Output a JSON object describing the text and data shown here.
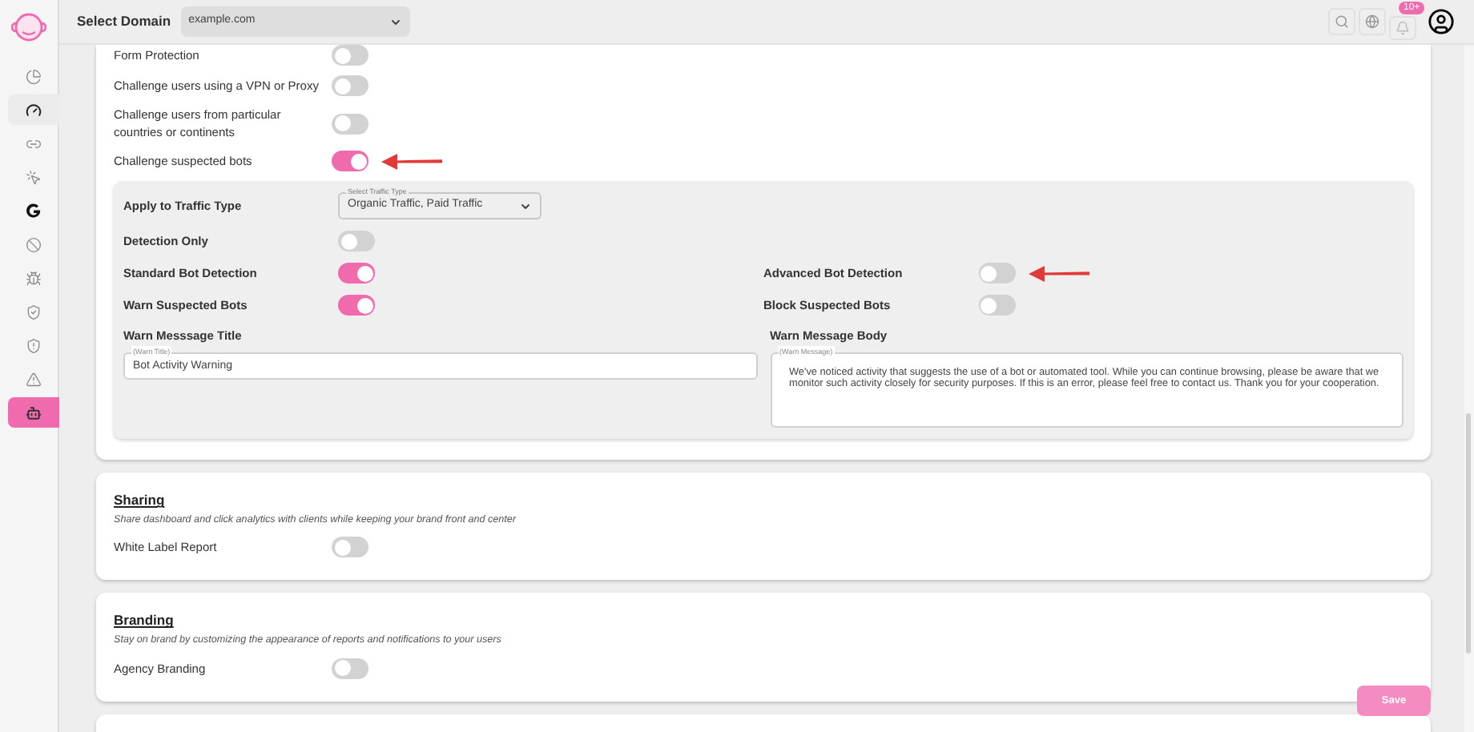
{
  "header": {
    "label": "Select Domain",
    "domain": "example.com",
    "notification_badge": "10+"
  },
  "sidebar": {
    "items": [
      {
        "kind": "chart",
        "selected": false,
        "highlighted": false
      },
      {
        "kind": "gauge",
        "selected": false,
        "highlighted": true
      },
      {
        "kind": "link",
        "selected": false,
        "highlighted": false
      },
      {
        "kind": "click",
        "selected": false,
        "highlighted": false
      },
      {
        "kind": "google",
        "selected": false,
        "highlighted": false
      },
      {
        "kind": "ban",
        "selected": false,
        "highlighted": false
      },
      {
        "kind": "bug",
        "selected": false,
        "highlighted": false
      },
      {
        "kind": "shield-check",
        "selected": false,
        "highlighted": false
      },
      {
        "kind": "shield-alert",
        "selected": false,
        "highlighted": false
      },
      {
        "kind": "warning",
        "selected": false,
        "highlighted": false
      },
      {
        "kind": "bot",
        "selected": true,
        "highlighted": false
      }
    ]
  },
  "protection": {
    "toggles": [
      {
        "label": "Form Protection",
        "on": false,
        "arrow": false
      },
      {
        "label": "Challenge users using a VPN or Proxy",
        "on": false,
        "arrow": false
      },
      {
        "label": "Challenge users from particular countries or continents",
        "on": false,
        "arrow": false
      },
      {
        "label": "Challenge suspected bots",
        "on": true,
        "arrow": true
      }
    ]
  },
  "bot_settings": {
    "traffic": {
      "label": "Apply to Traffic Type",
      "field_label": "Select Traffic Type",
      "value": "Organic Traffic, Paid Traffic"
    },
    "detection_only": {
      "label": "Detection Only",
      "on": false
    },
    "grid": [
      {
        "label": "Standard Bot Detection",
        "on": true,
        "arrow": false
      },
      {
        "label": "Advanced Bot Detection",
        "on": false,
        "arrow": true
      },
      {
        "label": "Warn Suspected Bots",
        "on": true,
        "arrow": false
      },
      {
        "label": "Block Suspected Bots",
        "on": false,
        "arrow": false
      }
    ],
    "warn_title": {
      "label": "Warn Messsage Title",
      "field_label": "(Warn Title)",
      "value": "Bot Activity Warning"
    },
    "warn_body": {
      "label": "Warn Message Body",
      "field_label": "(Warn Message)",
      "value": "We've noticed activity that suggests the use of a bot or automated tool. While you can continue browsing, please be aware that we monitor such activity closely for security purposes. If this is an error, please feel free to contact us. Thank you for your cooperation."
    }
  },
  "sections": [
    {
      "title": "Sharing",
      "description": "Share dashboard and click analytics with clients while keeping your brand front and center",
      "toggle": {
        "label": "White Label Report",
        "on": false
      }
    },
    {
      "title": "Branding",
      "description": "Stay on brand by customizing the appearance of reports and notifications to your users",
      "toggle": {
        "label": "Agency Branding",
        "on": false
      }
    }
  ],
  "save_button": "Save"
}
